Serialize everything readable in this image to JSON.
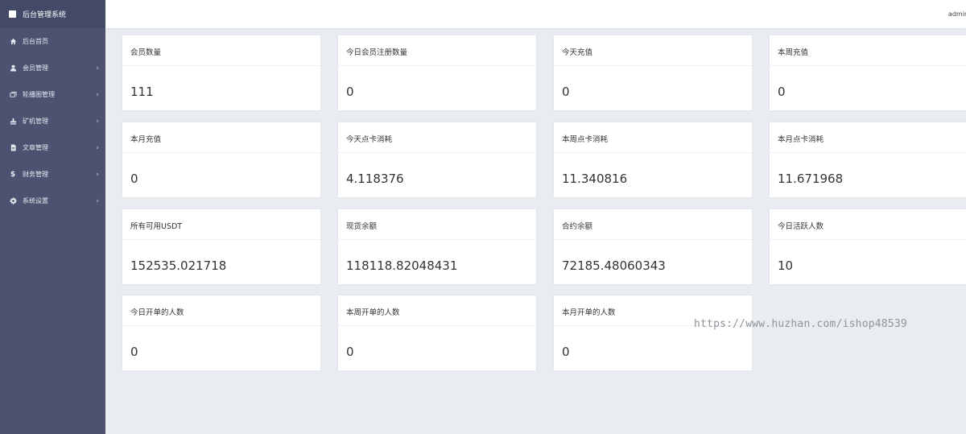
{
  "brand": {
    "title": "后台管理系统"
  },
  "sidebar": {
    "items": [
      {
        "label": "后台首页",
        "icon": "home-icon"
      },
      {
        "label": "会员管理",
        "icon": "user-icon"
      },
      {
        "label": "轮播图管理",
        "icon": "image-icon"
      },
      {
        "label": "矿机管理",
        "icon": "pickaxe-icon"
      },
      {
        "label": "文章管理",
        "icon": "document-icon"
      },
      {
        "label": "财务管理",
        "icon": "dollar-icon"
      },
      {
        "label": "系统设置",
        "icon": "gear-icon"
      }
    ]
  },
  "header": {
    "user": "admin"
  },
  "stats": [
    {
      "label": "会员数量",
      "value": "111"
    },
    {
      "label": "今日会员注册数量",
      "value": "0"
    },
    {
      "label": "今天充值",
      "value": "0"
    },
    {
      "label": "本周充值",
      "value": "0"
    },
    {
      "label": "本月充值",
      "value": "0"
    },
    {
      "label": "今天点卡消耗",
      "value": "4.118376"
    },
    {
      "label": "本周点卡消耗",
      "value": "11.340816"
    },
    {
      "label": "本月点卡消耗",
      "value": "11.671968"
    },
    {
      "label": "所有可用USDT",
      "value": "152535.021718"
    },
    {
      "label": "现货余额",
      "value": "118118.82048431"
    },
    {
      "label": "合约余额",
      "value": "72185.48060343"
    },
    {
      "label": "今日活跃人数",
      "value": "10"
    },
    {
      "label": "今日开单的人数",
      "value": "0"
    },
    {
      "label": "本周开单的人数",
      "value": "0"
    },
    {
      "label": "本月开单的人数",
      "value": "0"
    }
  ],
  "watermark": "https://www.huzhan.com/ishop48539"
}
